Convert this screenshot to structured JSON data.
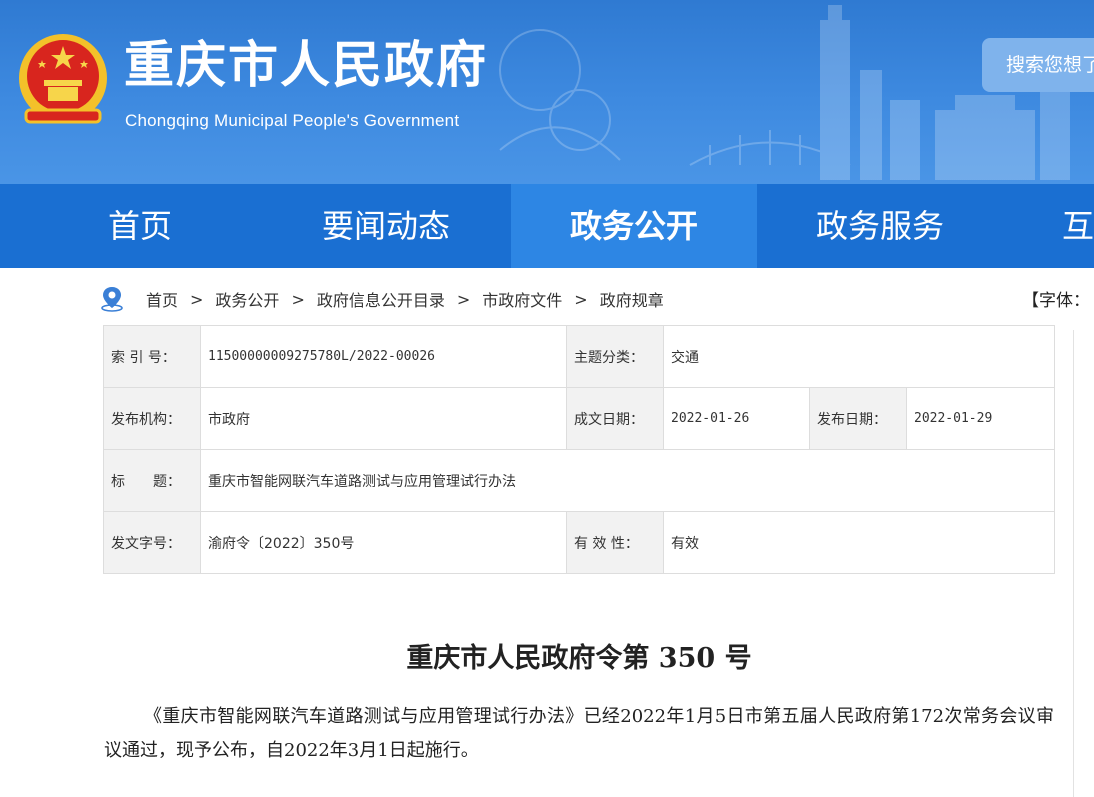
{
  "header": {
    "title": "重庆市人民政府",
    "subtitle": "Chongqing Municipal People's Government",
    "search_placeholder": "搜索您想了解的"
  },
  "nav": {
    "items": [
      {
        "label": "首页"
      },
      {
        "label": "要闻动态"
      },
      {
        "label": "政务公开"
      },
      {
        "label": "政务服务"
      },
      {
        "label": "互动交流"
      }
    ],
    "active_index": 2
  },
  "breadcrumb": {
    "items": [
      "首页",
      "政务公开",
      "政府信息公开目录",
      "市政府文件",
      "政府规章"
    ],
    "separator": ">"
  },
  "font_size_control": "【字体：",
  "info": {
    "index_label": "索 引 号：",
    "index_value": "11500000009275780L/2022-00026",
    "topic_label": "主题分类：",
    "topic_value": "交通",
    "issuer_label": "发布机构：",
    "issuer_value": "市政府",
    "written_label": "成文日期：",
    "written_value": "2022-01-26",
    "published_label": "发布日期：",
    "published_value": "2022-01-29",
    "title_label": "标　　题：",
    "title_value": "重庆市智能网联汽车道路测试与应用管理试行办法",
    "docno_label": "发文字号：",
    "docno_value": "渝府令〔2022〕350号",
    "validity_label": "有 效 性：",
    "validity_value": "有效"
  },
  "document": {
    "heading": "重庆市人民政府令第 350 号",
    "paragraph": "《重庆市智能网联汽车道路测试与应用管理试行办法》已经2022年1月5日市第五届人民政府第172次常务会议审议通过，现予公布，自2022年3月1日起施行。"
  },
  "colors": {
    "header_blue": "#3e8ae0",
    "nav_blue": "#1a6fd2",
    "nav_active": "#2d86e4",
    "label_bg": "#f2f2f2"
  }
}
